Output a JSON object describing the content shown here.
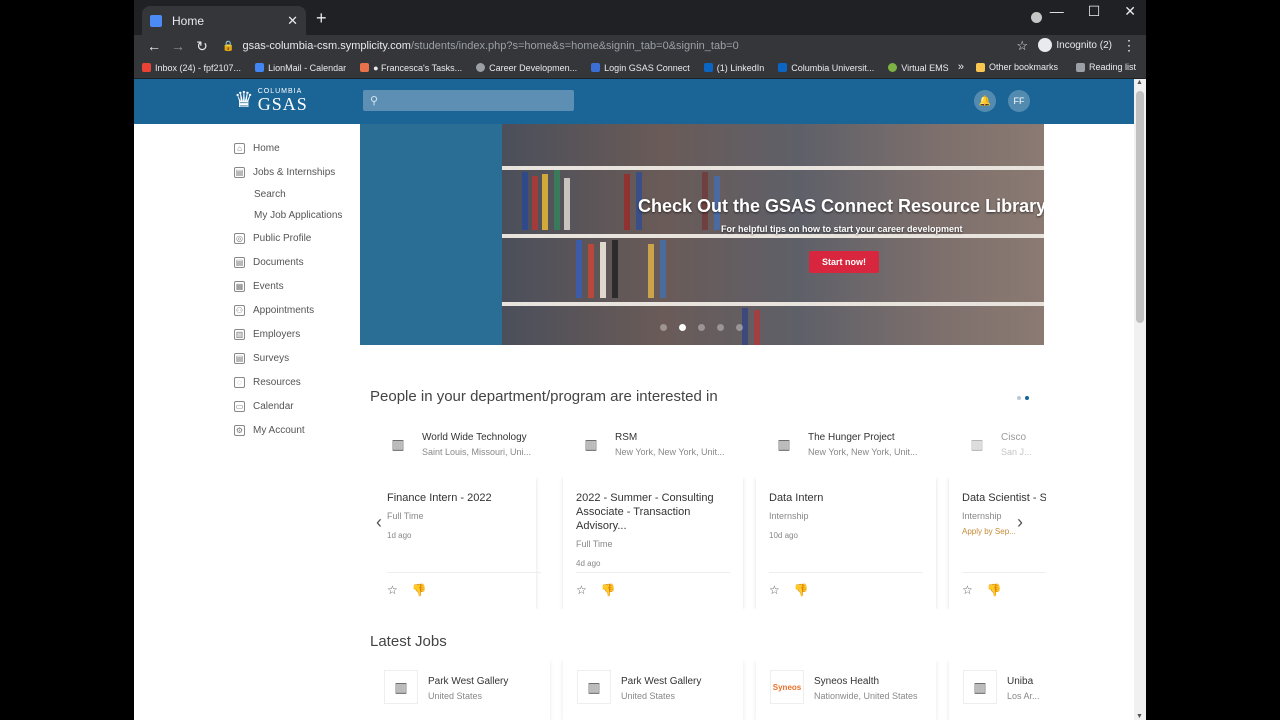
{
  "browser": {
    "tab_title": "Home",
    "tab_close": "✕",
    "new_tab": "+",
    "window_controls": [
      "—",
      "☐",
      "✕"
    ],
    "url_host": "gsas-columbia-csm.symplicity.com",
    "url_path": "/students/index.php?s=home&s=home&signin_tab=0&signin_tab=0",
    "incognito_label": "Incognito (2)",
    "bookmarks": [
      "Inbox (24) - fpf2107...",
      "LionMail - Calendar",
      "● Francesca's Tasks...",
      "Career Developmen...",
      "Login GSAS Connect",
      "(1) LinkedIn",
      "Columbia Universit...",
      "Virtual EMS"
    ],
    "bookmarks_more": "»",
    "other_bookmarks": "Other bookmarks",
    "reading_list": "Reading list"
  },
  "header": {
    "logo_small": "COLUMBIA",
    "logo_big": "GSAS",
    "search_placeholder": "",
    "avatar_initials": "FF"
  },
  "sidebar": {
    "items": [
      {
        "label": "Home",
        "icon": "⌂"
      },
      {
        "label": "Jobs & Internships",
        "icon": "▤"
      },
      {
        "label": "Public Profile",
        "icon": "◎"
      },
      {
        "label": "Documents",
        "icon": "▤"
      },
      {
        "label": "Events",
        "icon": "▦"
      },
      {
        "label": "Appointments",
        "icon": "⚇"
      },
      {
        "label": "Employers",
        "icon": "▥"
      },
      {
        "label": "Surveys",
        "icon": "▤"
      },
      {
        "label": "Resources",
        "icon": "◌"
      },
      {
        "label": "Calendar",
        "icon": "▭"
      },
      {
        "label": "My Account",
        "icon": "⚙"
      }
    ],
    "sub_items": [
      "Search",
      "My Job Applications"
    ]
  },
  "banner": {
    "title": "Check Out the GSAS Connect Resource Library",
    "subtitle": "For helpful tips on how to start your career development",
    "button": "Start now!"
  },
  "interested": {
    "title": "People in your department/program are interested in",
    "companies": [
      {
        "name": "World Wide Technology",
        "location": "Saint Louis, Missouri, Uni..."
      },
      {
        "name": "RSM",
        "location": "New York, New York, Unit..."
      },
      {
        "name": "The Hunger Project",
        "location": "New York, New York, Unit..."
      },
      {
        "name": "Cisco",
        "location": "San J..."
      }
    ],
    "jobs": [
      {
        "title": "Finance Intern - 2022",
        "type": "Full Time",
        "age": "1d ago",
        "apply": ""
      },
      {
        "title": "2022 - Summer - Consulting Associate - Transaction Advisory...",
        "type": "Full Time",
        "age": "4d ago",
        "apply": ""
      },
      {
        "title": "Data Intern",
        "type": "Internship",
        "age": "10d ago",
        "apply": ""
      },
      {
        "title": "Data Scientist - States",
        "type": "Internship",
        "age": "",
        "apply": "Apply by Sep..."
      }
    ]
  },
  "latest": {
    "title": "Latest Jobs",
    "items": [
      {
        "name": "Park West Gallery",
        "location": "United States"
      },
      {
        "name": "Park West Gallery",
        "location": "United States"
      },
      {
        "name": "Syneos Health",
        "location": "Nationwide, United States",
        "logo_text": "Syneos"
      },
      {
        "name": "Uniba",
        "location": "Los Ar..."
      }
    ]
  }
}
